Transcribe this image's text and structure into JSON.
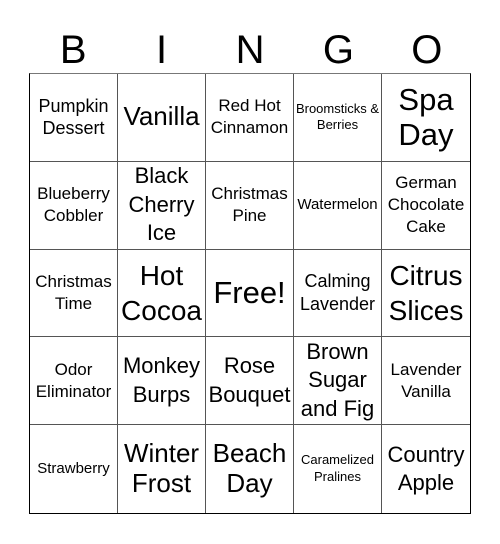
{
  "header": {
    "letters": [
      "B",
      "I",
      "N",
      "G",
      "O"
    ]
  },
  "cells": [
    "Pumpkin Dessert",
    "Vanilla",
    "Red Hot Cinnamon",
    "Broomsticks & Berries",
    "Spa Day",
    "Blueberry Cobbler",
    "Black Cherry Ice",
    "Christmas Pine",
    "Watermelon",
    "German Chocolate Cake",
    "Christmas Time",
    "Hot Cocoa",
    "Free!",
    "Calming Lavender",
    "Citrus Slices",
    "Odor Eliminator",
    "Monkey Burps",
    "Rose Bouquet",
    "Brown Sugar and Fig",
    "Lavender Vanilla",
    "Strawberry",
    "Winter Frost",
    "Beach Day",
    "Caramelized Pralines",
    "Country Apple"
  ]
}
